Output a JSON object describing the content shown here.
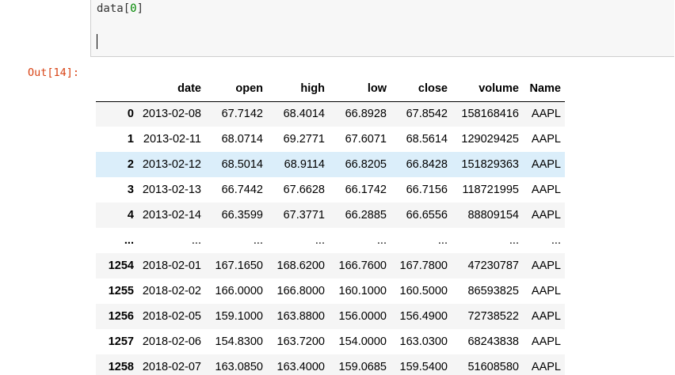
{
  "input_cell": {
    "code_name": "data",
    "code_open": "[",
    "code_index": "0",
    "code_close": "]"
  },
  "output": {
    "prompt": "Out[14]:"
  },
  "dataframe": {
    "columns": [
      "date",
      "open",
      "high",
      "low",
      "close",
      "volume",
      "Name"
    ],
    "rows": [
      {
        "index": "0",
        "cells": [
          "2013-02-08",
          "67.7142",
          "68.4014",
          "66.8928",
          "67.8542",
          "158168416",
          "AAPL"
        ]
      },
      {
        "index": "1",
        "cells": [
          "2013-02-11",
          "68.0714",
          "69.2771",
          "67.6071",
          "68.5614",
          "129029425",
          "AAPL"
        ]
      },
      {
        "index": "2",
        "cells": [
          "2013-02-12",
          "68.5014",
          "68.9114",
          "66.8205",
          "66.8428",
          "151829363",
          "AAPL"
        ]
      },
      {
        "index": "3",
        "cells": [
          "2013-02-13",
          "66.7442",
          "67.6628",
          "66.1742",
          "66.7156",
          "118721995",
          "AAPL"
        ]
      },
      {
        "index": "4",
        "cells": [
          "2013-02-14",
          "66.3599",
          "67.3771",
          "66.2885",
          "66.6556",
          "88809154",
          "AAPL"
        ]
      },
      {
        "index": "...",
        "cells": [
          "...",
          "...",
          "...",
          "...",
          "...",
          "...",
          "..."
        ]
      },
      {
        "index": "1254",
        "cells": [
          "2018-02-01",
          "167.1650",
          "168.6200",
          "166.7600",
          "167.7800",
          "47230787",
          "AAPL"
        ]
      },
      {
        "index": "1255",
        "cells": [
          "2018-02-02",
          "166.0000",
          "166.8000",
          "160.1000",
          "160.5000",
          "86593825",
          "AAPL"
        ]
      },
      {
        "index": "1256",
        "cells": [
          "2018-02-05",
          "159.1000",
          "163.8800",
          "156.0000",
          "156.4900",
          "72738522",
          "AAPL"
        ]
      },
      {
        "index": "1257",
        "cells": [
          "2018-02-06",
          "154.8300",
          "163.7200",
          "154.0000",
          "163.0300",
          "68243838",
          "AAPL"
        ]
      },
      {
        "index": "1258",
        "cells": [
          "2018-02-07",
          "163.0850",
          "163.4000",
          "159.0685",
          "159.5400",
          "51608580",
          "AAPL"
        ]
      }
    ],
    "hovered_row_index": "2"
  },
  "colors": {
    "prompt_out": "#d84315",
    "hover_row": "#dbeefa",
    "striped_row": "#f5f5f5"
  }
}
